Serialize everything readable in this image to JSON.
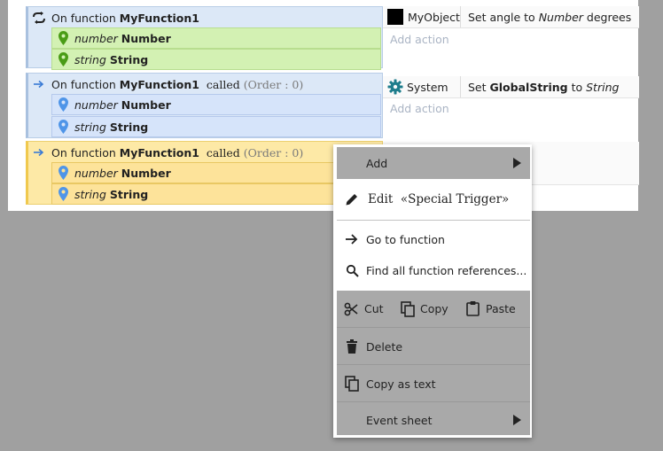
{
  "events": [
    {
      "prefix": "On function",
      "name": "MyFunction1",
      "called": "",
      "order": "",
      "params": [
        {
          "type": "number",
          "name": "Number"
        },
        {
          "type": "string",
          "name": "String"
        }
      ],
      "action": {
        "object": "MyObject",
        "text_a": "Set angle to",
        "text_b": "Number",
        "text_c": "degrees"
      }
    },
    {
      "prefix": "On function",
      "name": "MyFunction1",
      "called": "called",
      "order": "(Order : 0)",
      "params": [
        {
          "type": "number",
          "name": "Number"
        },
        {
          "type": "string",
          "name": "String"
        }
      ],
      "action": {
        "object": "System",
        "text_a": "Set",
        "text_b": "GlobalString",
        "text_c": "to",
        "text_d": "String"
      }
    },
    {
      "prefix": "On function",
      "name": "MyFunction1",
      "called": "called",
      "order": "(Order : 0)",
      "params": [
        {
          "type": "number",
          "name": "Number"
        },
        {
          "type": "string",
          "name": "String"
        }
      ]
    }
  ],
  "add_action_label": "Add action",
  "colors": {
    "green_param": "#d3f1b3",
    "blue_param": "#d6e4fa",
    "yellow_event": "#fde9a6",
    "menu_grey": "#a9a9a9",
    "accent_blue": "#3a7bd5"
  },
  "context_menu": {
    "add": "Add",
    "edit_prefix": "Edit",
    "edit_target": "«Special Trigger»",
    "go_to_function": "Go to function",
    "find_refs": "Find all function references...",
    "cut": "Cut",
    "copy": "Copy",
    "paste": "Paste",
    "delete": "Delete",
    "copy_as_text": "Copy as text",
    "event_sheet": "Event sheet"
  }
}
